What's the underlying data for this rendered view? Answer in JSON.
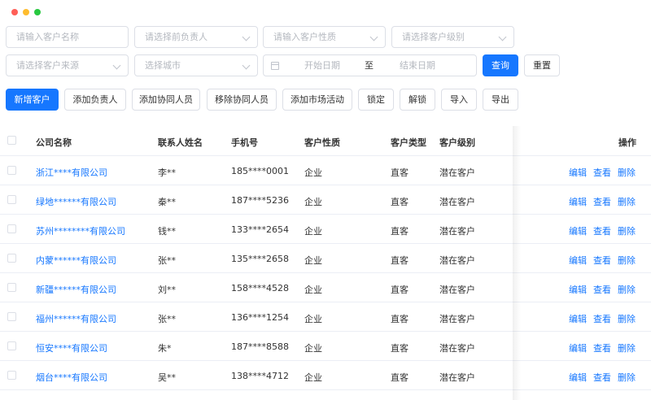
{
  "window": {
    "colors": [
      "#ff5f57",
      "#febc2e",
      "#28c840"
    ]
  },
  "filters": {
    "customer_name_placeholder": "请输入客户名称",
    "owner_placeholder": "请选择前负责人",
    "customer_nature_placeholder": "请输入客户性质",
    "customer_level_placeholder": "请选择客户级别",
    "customer_source_placeholder": "请选择客户来源",
    "city_placeholder": "选择城市",
    "start_date_placeholder": "开始日期",
    "date_separator": "至",
    "end_date_placeholder": "结束日期",
    "query_label": "查询",
    "reset_label": "重置"
  },
  "toolbar": {
    "add_customer": "新增客户",
    "add_owner": "添加负责人",
    "add_collaborator": "添加协同人员",
    "remove_collaborator": "移除协同人员",
    "add_market_activity": "添加市场活动",
    "lock": "锁定",
    "unlock": "解锁",
    "import": "导入",
    "export": "导出"
  },
  "table": {
    "headers": {
      "company": "公司名称",
      "contact": "联系人姓名",
      "phone": "手机号",
      "nature": "客户性质",
      "type": "客户类型",
      "level": "客户级别",
      "actions": "操作"
    },
    "action_labels": {
      "edit": "编辑",
      "view": "查看",
      "delete": "删除"
    },
    "rows": [
      {
        "company": "浙江****有限公司",
        "contact": "李**",
        "phone": "185****0001",
        "nature": "企业",
        "type": "直客",
        "level": "潜在客户"
      },
      {
        "company": "绿地******有限公司",
        "contact": "秦**",
        "phone": "187****5236",
        "nature": "企业",
        "type": "直客",
        "level": "潜在客户"
      },
      {
        "company": "苏州********有限公司",
        "contact": "钱**",
        "phone": "133****2654",
        "nature": "企业",
        "type": "直客",
        "level": "潜在客户"
      },
      {
        "company": "内蒙******有限公司",
        "contact": "张**",
        "phone": "135****2658",
        "nature": "企业",
        "type": "直客",
        "level": "潜在客户"
      },
      {
        "company": "新疆******有限公司",
        "contact": "刘**",
        "phone": "158****4528",
        "nature": "企业",
        "type": "直客",
        "level": "潜在客户"
      },
      {
        "company": "福州******有限公司",
        "contact": "张**",
        "phone": "136****1254",
        "nature": "企业",
        "type": "直客",
        "level": "潜在客户"
      },
      {
        "company": "恒安****有限公司",
        "contact": "朱*",
        "phone": "187****8588",
        "nature": "企业",
        "type": "直客",
        "level": "潜在客户"
      },
      {
        "company": "烟台****有限公司",
        "contact": "吴**",
        "phone": "138****4712",
        "nature": "企业",
        "type": "直客",
        "level": "潜在客户"
      }
    ]
  }
}
